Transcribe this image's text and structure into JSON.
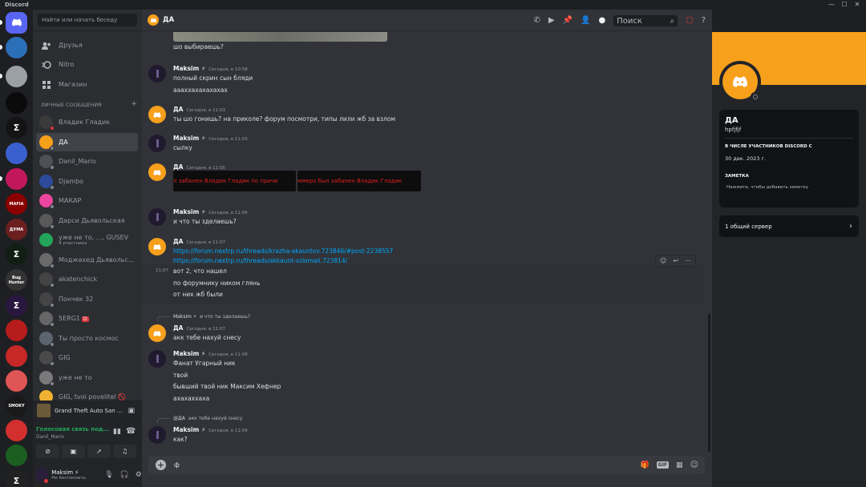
{
  "window": {
    "title": "Discord",
    "controls": [
      "—",
      "☐",
      "✕"
    ]
  },
  "colors": {
    "accent": "#5865f2",
    "green": "#23a55a",
    "link": "#00a8fc",
    "banner": "#f7a01c",
    "red": "#da373c"
  },
  "servers": [
    {
      "label": "",
      "color": "#5865f2",
      "icon": "discord-icon"
    },
    {
      "label": "",
      "color": "#2b6fb8",
      "icon": "server-icon"
    },
    {
      "label": "",
      "color": "#9aa0a6",
      "icon": "server-icon"
    },
    {
      "label": "",
      "color": "#0b0b0b",
      "icon": "server-icon"
    },
    {
      "label": "Σ",
      "color": "#141414",
      "icon": "sigma-icon"
    },
    {
      "label": "",
      "color": "#3a5fcf",
      "icon": "server-icon"
    },
    {
      "label": "",
      "color": "#c2185b",
      "icon": "server-icon"
    },
    {
      "label": "MAFIA",
      "color": "#8b0000",
      "icon": "server-icon"
    },
    {
      "label": "ДУМА",
      "color": "#6b1f1f",
      "icon": "server-icon"
    },
    {
      "label": "Σ",
      "color": "#101e14",
      "icon": "sigma-icon"
    },
    {
      "label": "Bug Hunter",
      "color": "#333333",
      "icon": "server-icon"
    },
    {
      "label": "Σ",
      "color": "#2a1740",
      "icon": "sigma-icon"
    },
    {
      "label": "",
      "color": "#b71c1c",
      "icon": "server-icon"
    },
    {
      "label": "",
      "color": "#c62828",
      "icon": "server-icon"
    },
    {
      "label": "",
      "color": "#e05555",
      "icon": "server-icon"
    },
    {
      "label": "SMOKY",
      "color": "#1a1a1a",
      "icon": "server-icon"
    },
    {
      "label": "",
      "color": "#d32f2f",
      "icon": "server-icon"
    },
    {
      "label": "",
      "color": "#1b5e20",
      "icon": "server-icon"
    },
    {
      "label": "Σ",
      "color": "#222",
      "icon": "sigma-icon"
    }
  ],
  "sidebar": {
    "search_placeholder": "Найти или начать беседу",
    "nav": [
      {
        "label": "Друзья",
        "icon": "friends-icon"
      },
      {
        "label": "Nitro",
        "icon": "nitro-icon"
      },
      {
        "label": "Магазин",
        "icon": "shop-icon"
      }
    ],
    "dm_header": "ЛИЧНЫЕ СООБЩЕНИЯ",
    "dm_add": "+",
    "dms": [
      {
        "name": "Владик Гладик",
        "sub": "",
        "color": "#3a3a3a",
        "status": "#da373c"
      },
      {
        "name": "ДА",
        "sub": "",
        "color": "#f7a01c",
        "status": "#80848e",
        "active": true
      },
      {
        "name": "Danil_Mario",
        "sub": "",
        "color": "#4e5058",
        "status": "#80848e"
      },
      {
        "name": "Djambo",
        "sub": "",
        "color": "#2d4b9a",
        "status": "#80848e"
      },
      {
        "name": "МАКАР",
        "sub": "",
        "color": "#eb459e",
        "status": "#80848e"
      },
      {
        "name": "Дарси Дьявольская",
        "sub": "",
        "color": "#5a5a5a",
        "status": "#80848e"
      },
      {
        "name": "уже не то, ..., GUSEV",
        "sub": "4 участника",
        "color": "#23a55a",
        "status": ""
      },
      {
        "name": "Моджахед Дьявольс...",
        "sub": "",
        "color": "#6a6a6a",
        "status": "#80848e"
      },
      {
        "name": "akatenchick",
        "sub": "",
        "color": "#444",
        "status": "#80848e"
      },
      {
        "name": "Пончек 32",
        "sub": "",
        "color": "#444",
        "status": "#80848e"
      },
      {
        "name": "5ERG1",
        "sub": "",
        "color": "#666",
        "status": "#80848e",
        "badge": "D"
      },
      {
        "name": "Ты просто космос",
        "sub": "",
        "color": "#5c6470",
        "status": "#80848e"
      },
      {
        "name": "GIG",
        "sub": "",
        "color": "#4a4a4a",
        "status": "#80848e"
      },
      {
        "name": "уже не то",
        "sub": "",
        "color": "#7a7a7a",
        "status": "#80848e"
      },
      {
        "name": "GIG, tvoi povelitel 🚫",
        "sub": "",
        "color": "#f0b232",
        "status": ""
      }
    ],
    "activity": {
      "game": "Grand Theft Auto San ..."
    },
    "voice": {
      "status": "Голосовая связь под...",
      "channel": "Danil_Mario"
    },
    "user": {
      "name": "Maksim ⚡",
      "status": "Не беспокоить"
    }
  },
  "channel": {
    "name": "ДА",
    "search_placeholder": "Поиск"
  },
  "messages": [
    {
      "type": "cont",
      "lines": [
        "шо выбираешь?"
      ]
    },
    {
      "author": "Maksim ⚡",
      "time": "Сегодня, в 10:58",
      "av": "dark",
      "lines": [
        "полный скрин сын бляди",
        "аааххахахахахах"
      ]
    },
    {
      "author": "ДА",
      "time": "Сегодня, в 11:03",
      "av": "discord",
      "lines": [
        "ты шо гонишь? на приколе? форум посмотри, типы лили жб за взлом"
      ]
    },
    {
      "author": "Maksim ⚡",
      "time": "Сегодня, в 11:03",
      "av": "dark",
      "lines": [
        "сылку"
      ]
    },
    {
      "author": "ДА",
      "time": "Сегодня, в 11:05",
      "av": "discord",
      "images": [
        "л забанен Владик Гладик по причи",
        "ммерз был забанен Владик Гладик"
      ]
    },
    {
      "author": "Maksim ⚡",
      "time": "Сегодня, в 11:06",
      "av": "dark",
      "lines": [
        "и что ты зделаешь?"
      ]
    },
    {
      "author": "ДА",
      "time": "Сегодня, в 11:07",
      "av": "discord",
      "links": [
        "https://forum.nextrp.ru/threads/krazha-akauntov.723846/#post-2238557",
        "https://forum.nextrp.ru/threads/akkaunt-vzlomali.723814/"
      ]
    },
    {
      "type": "cont",
      "hover_time": "11:07",
      "lines": [
        "вот 2, что нашел",
        "по форумнику ником глянь",
        "от них жб были"
      ]
    },
    {
      "author": "ДА",
      "time": "Сегодня, в 11:07",
      "av": "discord",
      "reply": {
        "name": "Maksim ⚡",
        "text": "и что ты зделаешь?"
      },
      "lines": [
        "акк тебе нахуй снесу"
      ]
    },
    {
      "author": "Maksim ⚡",
      "time": "Сегодня, в 11:08",
      "av": "dark",
      "lines": [
        "Фанат Угарный ник",
        "твой",
        "бывший твой ник Максим Хефнер",
        "ахахаххаха"
      ]
    },
    {
      "author": "Maksim ⚡",
      "time": "Сегодня, в 11:09",
      "av": "dark",
      "reply": {
        "name": "@ДА",
        "text": "акк тебе нахуй снесу"
      },
      "lines": [
        "как?"
      ]
    }
  ],
  "composer": {
    "value": "ф"
  },
  "profile": {
    "name": "ДА",
    "username": "hpfjfjf",
    "member_since_label": "В ЧИСЛЕ УЧАСТНИКОВ DISCORD С",
    "member_since": "30 дек. 2023 г.",
    "note_label": "ЗАМЕТКА",
    "note_placeholder": "Нажмите, чтобы добавить заметку",
    "mutual": "1 общий сервер"
  }
}
